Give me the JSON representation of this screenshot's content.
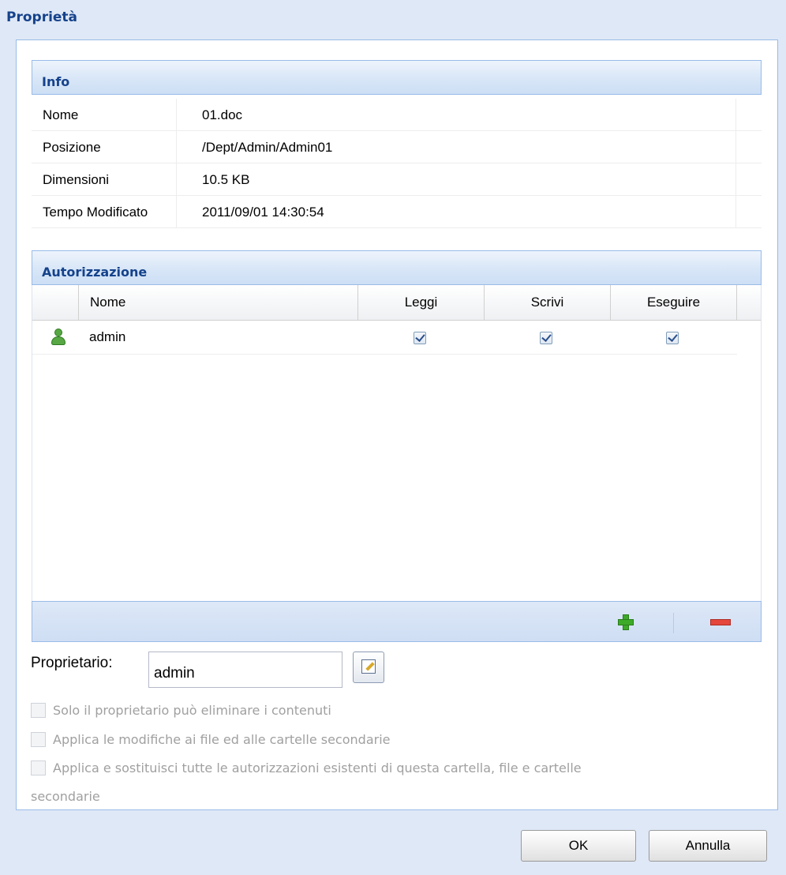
{
  "dialog": {
    "title": "Proprietà"
  },
  "info": {
    "header": "Info",
    "rows": [
      {
        "label": "Nome",
        "value": "01.doc"
      },
      {
        "label": "Posizione",
        "value": "/Dept/Admin/Admin01"
      },
      {
        "label": "Dimensioni",
        "value": "10.5 KB"
      },
      {
        "label": "Tempo Modificato",
        "value": "2011/09/01 14:30:54"
      }
    ]
  },
  "permissions": {
    "header": "Autorizzazione",
    "columns": {
      "name": "Nome",
      "read": "Leggi",
      "write": "Scrivi",
      "execute": "Eseguire"
    },
    "rows": [
      {
        "name": "admin",
        "read": true,
        "write": true,
        "execute": true,
        "icon": "user-icon"
      }
    ],
    "add_icon": "plus-icon",
    "remove_icon": "minus-icon"
  },
  "owner": {
    "label": "Proprietario:",
    "value": "admin",
    "edit_icon": "pencil-icon"
  },
  "options": {
    "owner_only_delete": "Solo il proprietario può eliminare i contenuti",
    "apply_subfolders": "Applica le modifiche ai file ed alle cartelle secondarie",
    "replace_all_line1": "Applica e sostituisci tutte le autorizzazioni esistenti di questa cartella, file e cartelle",
    "replace_all_line2": "secondarie"
  },
  "buttons": {
    "ok": "OK",
    "cancel": "Annulla"
  }
}
